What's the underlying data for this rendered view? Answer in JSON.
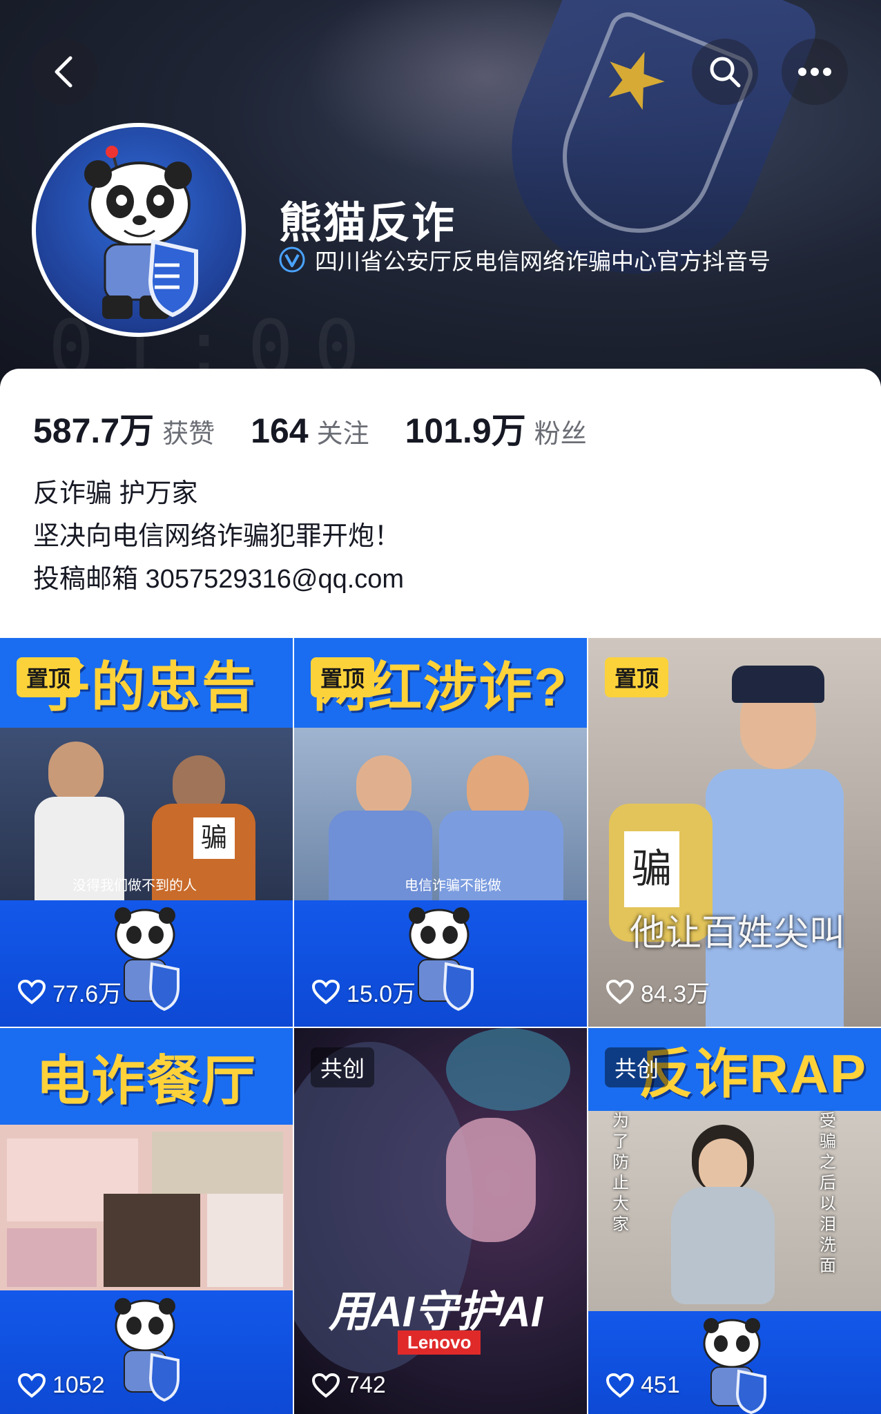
{
  "header": {
    "profile_name": "熊猫反诈",
    "verification": "四川省公安厅反电信网络诈骗中心官方抖音号",
    "accent_color": "#2d7cf6"
  },
  "stats": [
    {
      "value": "587.7万",
      "label": "获赞"
    },
    {
      "value": "164",
      "label": "关注"
    },
    {
      "value": "101.9万",
      "label": "粉丝"
    }
  ],
  "bio": {
    "line1": "反诈骗 护万家",
    "line2": "坚决向电信网络诈骗犯罪开炮！",
    "line3": "投稿邮箱 3057529316@qq.com"
  },
  "videos": [
    {
      "tag": "置顶",
      "title": "子的忠告",
      "caption": "没得我们做不到的人",
      "likes": "77.6万"
    },
    {
      "tag": "置顶",
      "title": "网红涉诈?",
      "caption": "电信诈骗不能做",
      "likes": "15.0万"
    },
    {
      "tag": "置顶",
      "overlay": "他让百姓尖叫",
      "sign": "骗",
      "likes": "84.3万"
    },
    {
      "tag": "",
      "title": "电诈餐厅",
      "likes": "1052"
    },
    {
      "tag": "共创",
      "overlay": "用AI守护AI",
      "brand": "Lenovo",
      "likes": "742"
    },
    {
      "tag": "共创",
      "title": "反诈RAP",
      "left_text": "为了防止大家",
      "right_text": "受骗之后以泪洗面",
      "likes": "451"
    }
  ],
  "icons": [
    "back-icon",
    "search-icon",
    "more-icon",
    "verified-icon",
    "heart-icon"
  ]
}
